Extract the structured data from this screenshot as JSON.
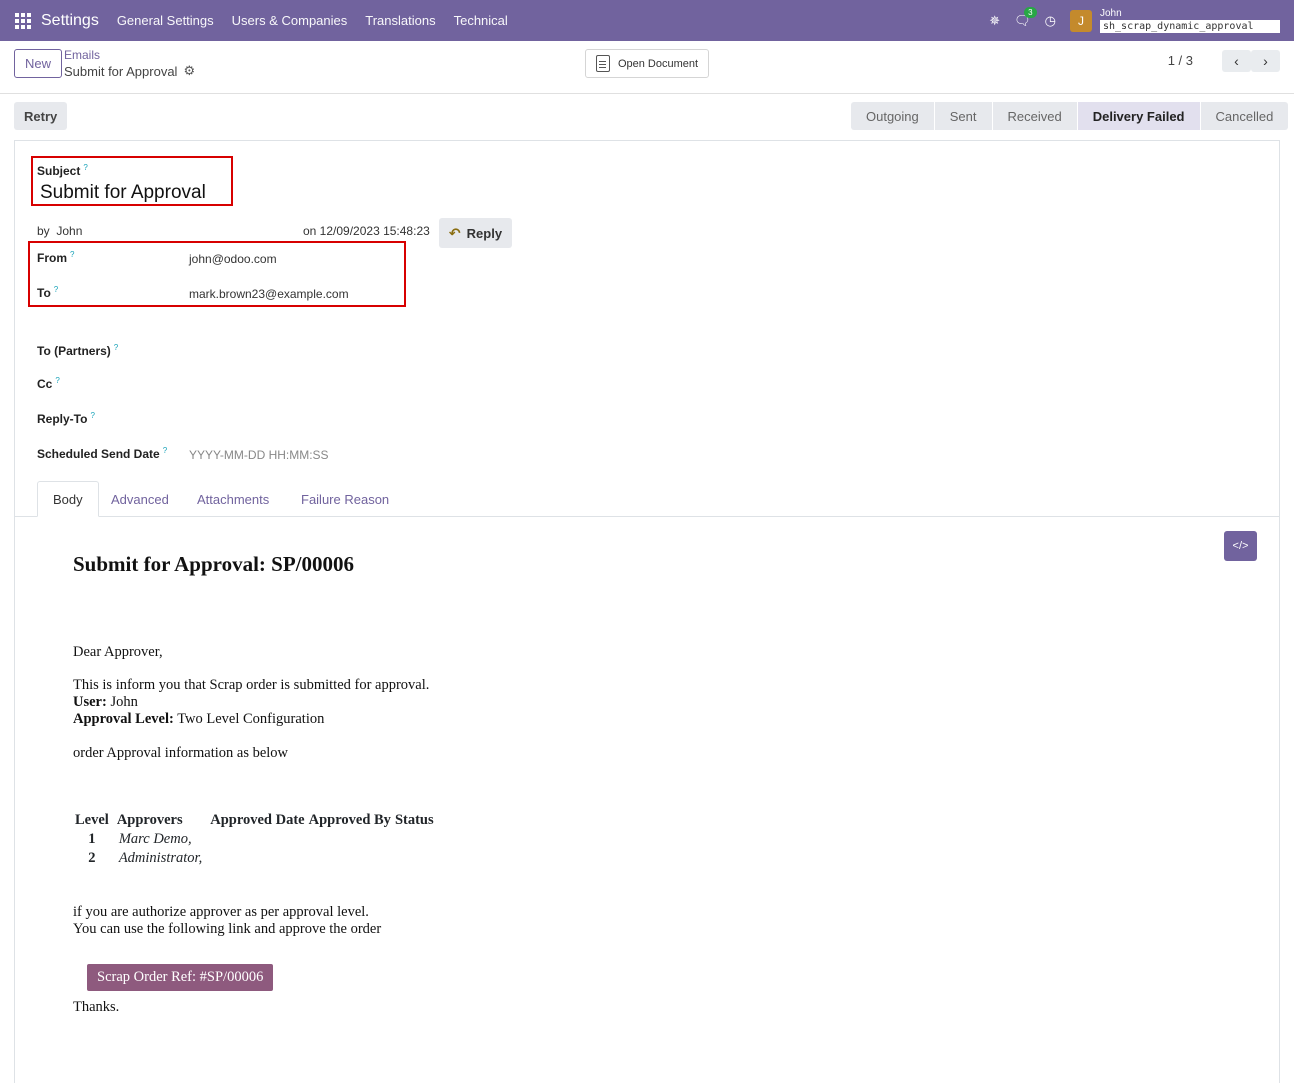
{
  "navbar": {
    "brand": "Settings",
    "menu": [
      "General Settings",
      "Users & Companies",
      "Translations",
      "Technical"
    ],
    "chat_badge": "3",
    "avatar_letter": "J",
    "user_name": "John",
    "db_name": "sh_scrap_dynamic_approval"
  },
  "control": {
    "new_label": "New",
    "breadcrumb_parent": "Emails",
    "breadcrumb_current": "Submit for Approval",
    "open_document_label": "Open Document",
    "pager": "1 / 3"
  },
  "actions": {
    "retry_label": "Retry"
  },
  "statusbar": [
    "Outgoing",
    "Sent",
    "Received",
    "Delivery Failed",
    "Cancelled"
  ],
  "statusbar_active": "Delivery Failed",
  "form": {
    "subject_label": "Subject",
    "subject_value": "Submit for Approval",
    "by_label": "by",
    "by_value": "John",
    "date_text": "on 12/09/2023 15:48:23",
    "reply_label": "Reply",
    "from_label": "From",
    "from_value": "john@odoo.com",
    "to_label": "To",
    "to_value": "mark.brown23@example.com",
    "to_partners_label": "To (Partners)",
    "cc_label": "Cc",
    "reply_to_label": "Reply-To",
    "scheduled_label": "Scheduled Send Date",
    "scheduled_placeholder": "YYYY-MM-DD HH:MM:SS",
    "help_mark": "?"
  },
  "tabs": [
    "Body",
    "Advanced",
    "Attachments",
    "Failure Reason"
  ],
  "body": {
    "title": "Submit for Approval: SP/00006",
    "greeting": "Dear Approver,",
    "line1": "This is inform you that Scrap order is submitted for approval.",
    "user_label": "User:",
    "user_value": " John",
    "level_label": "Approval Level:",
    "level_value": " Two Level Configuration",
    "info_line": "order Approval information as below",
    "table_headers": [
      "Level",
      "Approvers",
      "Approved Date",
      "Approved By",
      "Status"
    ],
    "table_rows": [
      {
        "level": "1",
        "approver": "Marc Demo,"
      },
      {
        "level": "2",
        "approver": "Administrator,"
      }
    ],
    "line_auth": "if you are authorize approver as per approval level.",
    "line_link": "You can use the following link and approve the order",
    "button_label": "Scrap Order Ref: #SP/00006",
    "thanks": "Thanks."
  },
  "colors": {
    "brand": "#71639e",
    "highlight_box": "#d70000",
    "mail_button": "#8e5a7e"
  }
}
